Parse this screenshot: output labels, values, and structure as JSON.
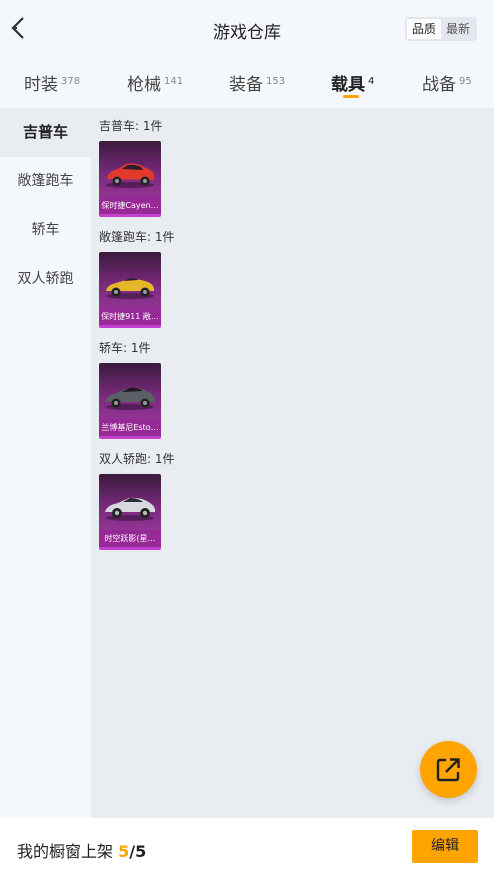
{
  "header": {
    "title": "游戏仓库",
    "sort_options": [
      "品质",
      "最新"
    ],
    "active_sort": "品质"
  },
  "tabs": [
    {
      "label": "时装",
      "count": "378"
    },
    {
      "label": "枪械",
      "count": "141"
    },
    {
      "label": "装备",
      "count": "153"
    },
    {
      "label": "载具",
      "count": "4"
    },
    {
      "label": "战备",
      "count": "95"
    }
  ],
  "active_tab": "载具",
  "sidebar": {
    "items": [
      "吉普车",
      "敞篷跑车",
      "轿车",
      "双人轿跑"
    ],
    "active": "吉普车"
  },
  "sections": [
    {
      "label": "吉普车: 1件",
      "item_name": "保时捷Cayen…",
      "car_color": "#e23a2a"
    },
    {
      "label": "敞篷跑车: 1件",
      "item_name": "保时捷911 敞…",
      "car_color": "#e7b72a"
    },
    {
      "label": "轿车: 1件",
      "item_name": "兰博基尼Esto…",
      "car_color": "#5b5f66"
    },
    {
      "label": "双人轿跑: 1件",
      "item_name": "时空跃影(星…",
      "car_color": "#d8d8e0"
    }
  ],
  "footer": {
    "prefix": "我的橱窗上架 ",
    "count": "5",
    "total": "/5",
    "edit_label": "编辑"
  },
  "colors": {
    "accent": "#ffa400",
    "card_purple": "#a33aa3"
  },
  "icons": {
    "back": "chevron-left-icon",
    "share": "share-external-icon"
  }
}
